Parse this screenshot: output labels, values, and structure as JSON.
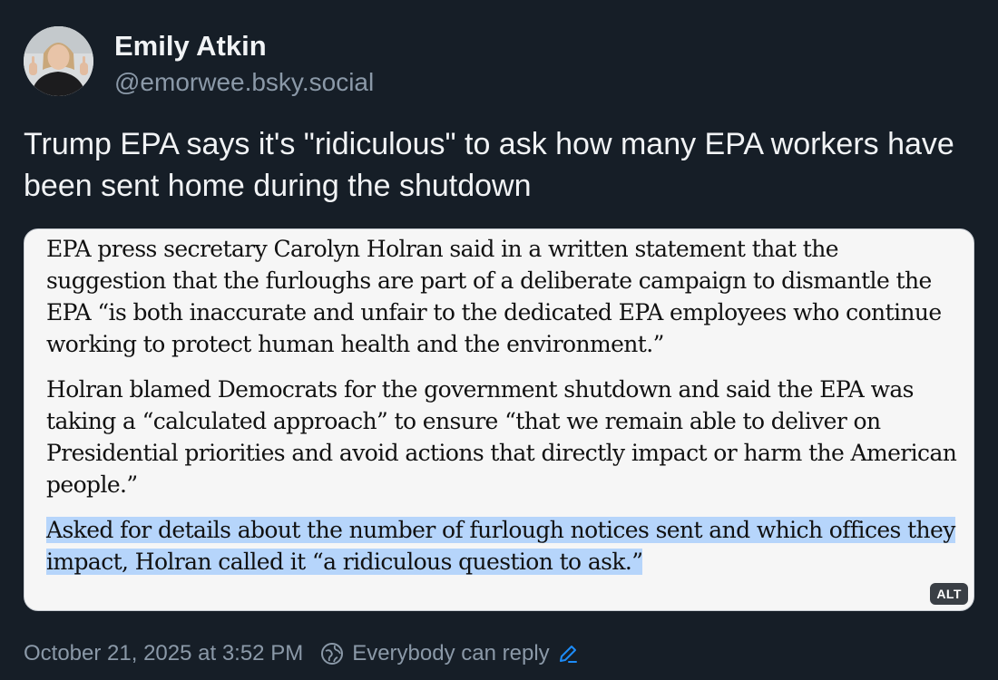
{
  "author": {
    "display_name": "Emily Atkin",
    "handle": "@emorwee.bsky.social",
    "avatar_icon": "avatar"
  },
  "post": {
    "text": "Trump EPA says it's \"ridiculous\" to ask how many EPA workers have been sent home during the shutdown"
  },
  "embed": {
    "paragraphs": [
      "EPA press secretary Carolyn Holran said in a written statement that the suggestion that the furloughs are part of a deliberate campaign to dismantle the EPA “is both inaccurate and unfair to the dedicated EPA employees who continue working to protect human health and the environment.”",
      "Holran blamed Democrats for the government shutdown and said the EPA was taking a “calculated approach” to ensure “that we remain able to deliver on Presidential priorities and avoid actions that directly impact or harm the American people.”",
      "Asked for details about the number of furlough notices sent and which offices they impact, Holran called it “a ridiculous question to ask.”"
    ],
    "alt_badge": "ALT",
    "highlight_color": "#b6d5fb"
  },
  "meta": {
    "timestamp": "October 21, 2025 at 3:52 PM",
    "reply_setting": "Everybody can reply",
    "reply_icon": "globe-reply-icon",
    "edit_icon": "pencil-icon",
    "accent_color": "#1d8cf8"
  },
  "colors": {
    "background": "#161e27",
    "text_primary": "#f1f3f5",
    "text_secondary": "#8b99a8"
  }
}
